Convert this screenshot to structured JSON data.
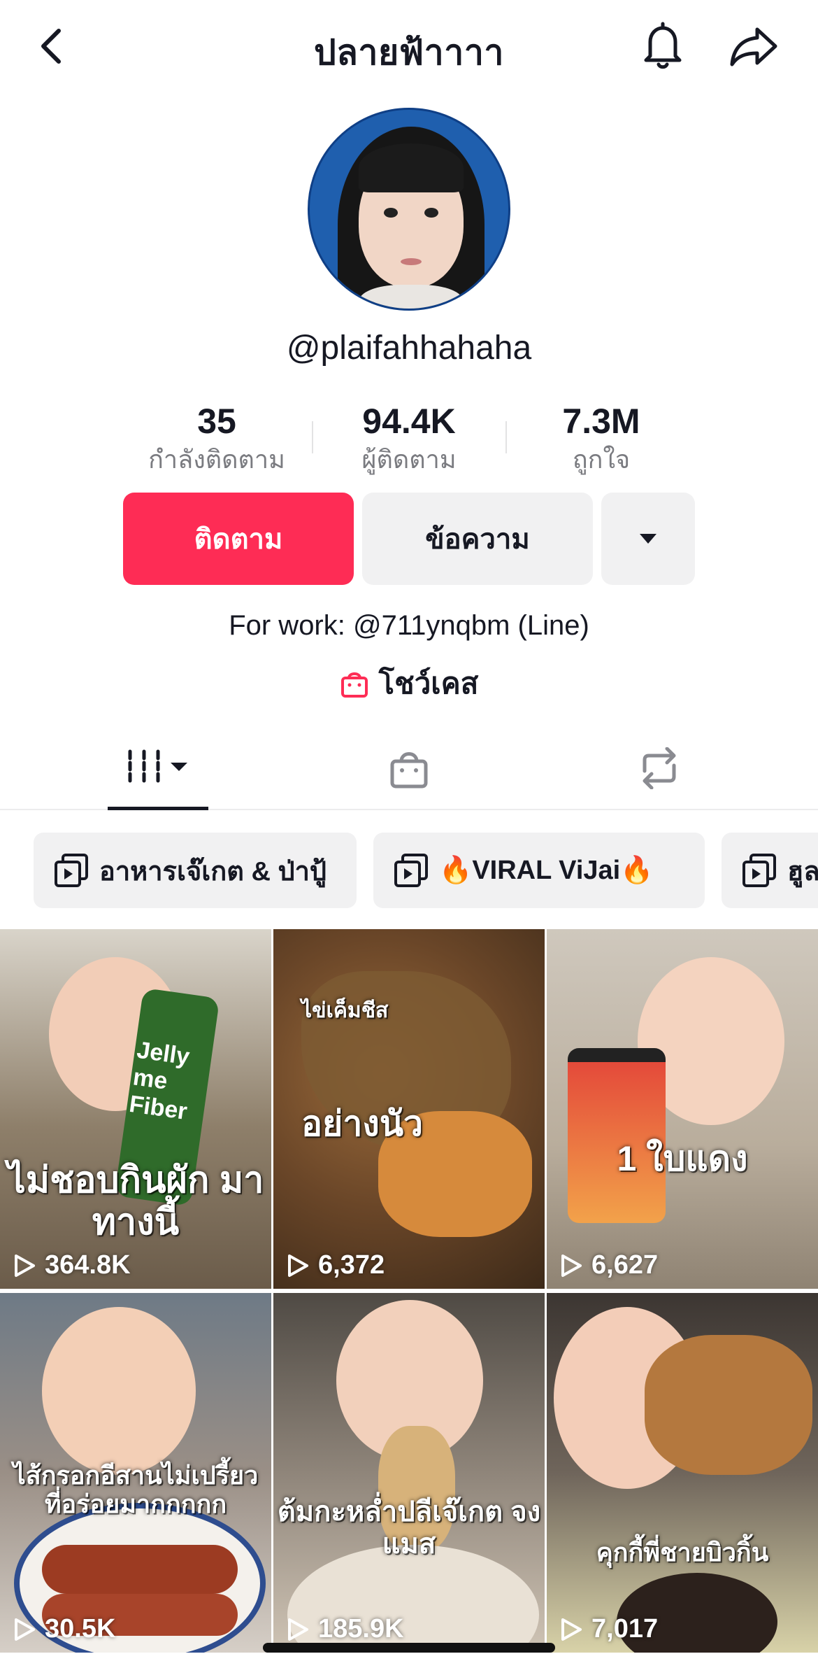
{
  "header": {
    "title": "ปลายฟ้าาาา",
    "back_icon": "chevron-left-icon",
    "bell_icon": "bell-icon",
    "share_icon": "share-arrow-icon"
  },
  "profile": {
    "username": "@plaifahhahaha",
    "stats": [
      {
        "value": "35",
        "label": "กำลังติดตาม"
      },
      {
        "value": "94.4K",
        "label": "ผู้ติดตาม"
      },
      {
        "value": "7.3M",
        "label": "ถูกใจ"
      }
    ],
    "follow_label": "ติดตาม",
    "message_label": "ข้อความ",
    "bio": "For work: @711ynqbm (Line)",
    "showcase_label": "โชว์เคส"
  },
  "tabs": [
    "videos-grid-icon",
    "shop-bag-icon",
    "repost-icon"
  ],
  "playlists": [
    {
      "label": "อาหารเจ๊เกต & ป่าปู้"
    },
    {
      "label": "🔥VIRAL ViJai🔥"
    },
    {
      "label": "ฮูล"
    }
  ],
  "videos": [
    {
      "title": "ไม่ชอบกินผัก มาทางนี้",
      "views": "364.8K",
      "caption": "Jelly me Fiber"
    },
    {
      "title": "อย่างนัว",
      "subtitle": "ไข่เค็มชีส",
      "views": "6,372"
    },
    {
      "title": "1 ใบแดง",
      "views": "6,627"
    },
    {
      "title": "ไส้กรอกอีสานไม่เปรี้ยว ที่อร่อยมากกกกก",
      "views": "30.5K"
    },
    {
      "title": "ต้มกะหล่ำปลีเจ๊เกต จงแมส",
      "views": "185.9K"
    },
    {
      "title": "คุกกี้พี่ชายบิวกิ้น",
      "views": "7,017"
    }
  ],
  "colors": {
    "accent": "#fe2c55",
    "text": "#161823",
    "secondary": "#7a7b80",
    "chip_bg": "#f1f1f2"
  }
}
